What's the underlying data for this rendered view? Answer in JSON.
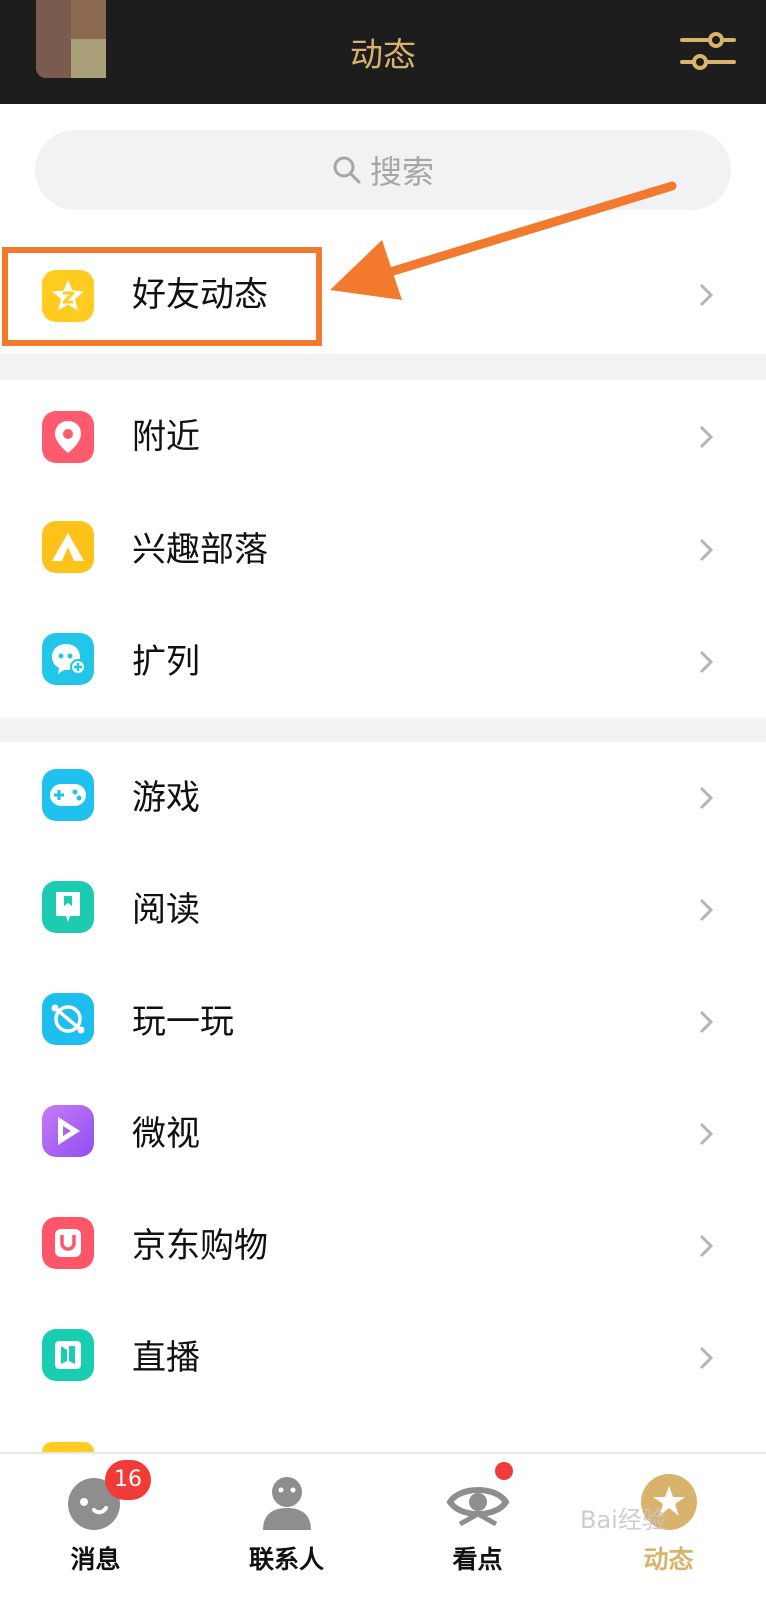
{
  "header": {
    "title": "动态"
  },
  "search": {
    "placeholder": "搜索"
  },
  "groups": [
    [
      {
        "label": "好友动态",
        "icon": "star-friends-icon"
      }
    ],
    [
      {
        "label": "附近",
        "icon": "location-pin-icon"
      },
      {
        "label": "兴趣部落",
        "icon": "tent-icon"
      },
      {
        "label": "扩列",
        "icon": "chat-add-icon"
      }
    ],
    [
      {
        "label": "游戏",
        "icon": "gamepad-icon"
      },
      {
        "label": "阅读",
        "icon": "book-icon"
      },
      {
        "label": "玩一玩",
        "icon": "planet-icon"
      },
      {
        "label": "微视",
        "icon": "play-icon"
      },
      {
        "label": "京东购物",
        "icon": "shopping-bag-icon"
      },
      {
        "label": "直播",
        "icon": "live-icon"
      }
    ]
  ],
  "tabbar": [
    {
      "label": "消息",
      "badge": "16"
    },
    {
      "label": "联系人"
    },
    {
      "label": "看点"
    },
    {
      "label": "动态"
    }
  ],
  "watermark": "Bai经验",
  "colors": {
    "accent": "#d9b36b",
    "highlight": "#f27a2f",
    "badge": "#f03b36"
  }
}
